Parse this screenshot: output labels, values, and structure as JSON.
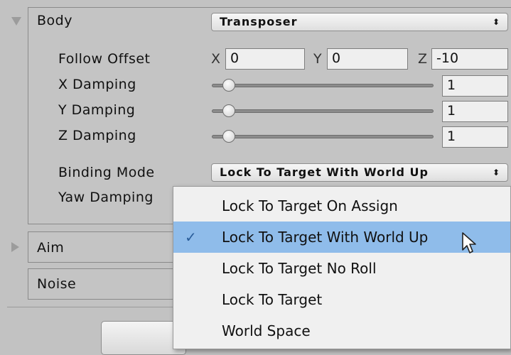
{
  "body_section": {
    "title": "Body",
    "component_value": "Transposer",
    "follow_offset": {
      "label": "Follow Offset",
      "x_label": "X",
      "x": "0",
      "y_label": "Y",
      "y": "0",
      "z_label": "Z",
      "z": "-10"
    },
    "x_damping": {
      "label": "X Damping",
      "value": "1",
      "slider_fraction": 0.05
    },
    "y_damping": {
      "label": "Y Damping",
      "value": "1",
      "slider_fraction": 0.05
    },
    "z_damping": {
      "label": "Z Damping",
      "value": "1",
      "slider_fraction": 0.05
    },
    "binding_mode": {
      "label": "Binding Mode",
      "value": "Lock To Target With World Up"
    },
    "yaw_damping": {
      "label": "Yaw Damping"
    }
  },
  "aim_section": {
    "title": "Aim"
  },
  "noise_section": {
    "title": "Noise"
  },
  "binding_mode_menu": {
    "selected_index": 1,
    "check_mark": "✓",
    "options": [
      "Lock To Target On Assign",
      "Lock To Target With World Up",
      "Lock To Target No Roll",
      "Lock To Target",
      "World Space"
    ]
  },
  "colors": {
    "background": "#c2c2c2",
    "selection": "#8fbcea",
    "menu_background": "#f0f0f0"
  }
}
